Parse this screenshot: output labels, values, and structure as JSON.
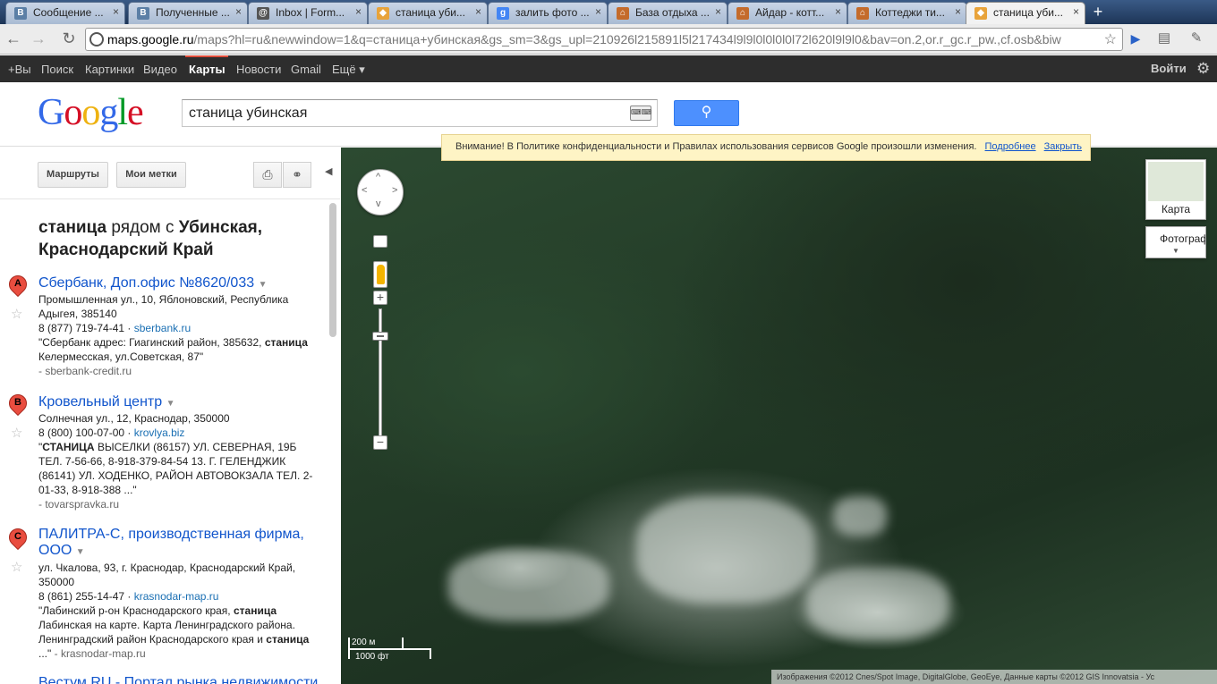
{
  "browser": {
    "tabs": [
      {
        "title": "Сообщение ...",
        "icon": "В",
        "icon_color": "#5b7fa6"
      },
      {
        "title": "Полученные ...",
        "icon": "В",
        "icon_color": "#5b7fa6"
      },
      {
        "title": "Inbox | Form...",
        "icon": "@",
        "icon_color": "#555555"
      },
      {
        "title": "станица уби...",
        "icon": "◆",
        "icon_color": "#e8a33a"
      },
      {
        "title": "залить фото ...",
        "icon": "g",
        "icon_color": "#4285f4"
      },
      {
        "title": "База отдыха ...",
        "icon": "⌂",
        "icon_color": "#c46b2b"
      },
      {
        "title": "Айдар - котт...",
        "icon": "⌂",
        "icon_color": "#c46b2b"
      },
      {
        "title": "Коттеджи ти...",
        "icon": "⌂",
        "icon_color": "#c46b2b"
      },
      {
        "title": "станица уби...",
        "icon": "◆",
        "icon_color": "#e8a33a",
        "active": true
      }
    ],
    "new_tab": "+",
    "url_host": "maps.google.ru",
    "url_rest": "/maps?hl=ru&newwindow=1&q=станица+убинская&gs_sm=3&gs_upl=210926l215891l5l217434l9l9l0l0l0l0l72l620l9l9l0&bav=on.2,or.r_gc.r_pw.,cf.osb&biw"
  },
  "gbar": {
    "items": [
      "+Вы",
      "Поиск",
      "Картинки",
      "Видео",
      "Карты",
      "Новости",
      "Gmail",
      "Ещё ▾"
    ],
    "selected": "Карты",
    "login": "Войти"
  },
  "search": {
    "query": "станица убинская",
    "logo": "Google"
  },
  "panel": {
    "routes_button": "Маршруты",
    "my_places_button": "Мои метки",
    "results_title_1": "станица",
    "results_title_2": " рядом с ",
    "results_title_3": "Убинская, Краснодарский Край",
    "results": [
      {
        "letter": "A",
        "name": "Сбербанк, Доп.офис №8620/033",
        "address": "Промышленная ул., 10, Яблоновский, Республика Адыгея, 385140",
        "phone": "8 (877) 719-74-41",
        "site": "sberbank.ru",
        "snippet_1": "\"Сбербанк адрес: Гиагинский район, 385632, ",
        "snippet_bold": "станица",
        "snippet_2": " Келермесская, ул.Советская, 87\"",
        "source": "- sberbank-credit.ru"
      },
      {
        "letter": "B",
        "name": "Кровельный центр",
        "address": "Солнечная ул., 12, Краснодар, 350000",
        "phone": "8 (800) 100-07-00",
        "site": "krovlya.biz",
        "snippet_1": "\"",
        "snippet_bold": "СТАНИЦА",
        "snippet_2": " ВЫСЕЛКИ (86157) УЛ. СЕВЕРНАЯ, 19Б ТЕЛ. 7-56-66, 8-918-379-84-54 13. Г. ГЕЛЕНДЖИК (86141) УЛ. ХОДЕНКО, РАЙОН АВТОВОКЗАЛА ТЕЛ. 2-01-33, 8-918-388 ...\"",
        "source": "- tovarspravka.ru"
      },
      {
        "letter": "C",
        "name": "ПАЛИТРА-С, производственная фирма, ООО",
        "address": "ул. Чкалова, 93, г. Краснодар, Краснодарский Край, 350000",
        "phone": "8 (861) 255-14-47",
        "site": "krasnodar-map.ru",
        "snippet_1": "\"Лабинский р-он Краснодарского края, ",
        "snippet_bold": "станица",
        "snippet_2": " Лабинская на карте. Карта Ленинградского района. Ленинградский район Краснодарского края и ",
        "snippet_bold2": "станица",
        "snippet_3": " ...\"",
        "source": "- krasnodar-map.ru"
      }
    ],
    "cut_off_text": "Вестум.RU - Портал рынка недвижимости"
  },
  "map": {
    "notice_text": "Внимание! В Политике конфиденциальности и Правилах использования сервисов Google произошли изменения.",
    "notice_more": "Подробнее",
    "notice_close": "Закрыть",
    "map_type_label": "Карта",
    "photo_label": "Фотограф",
    "scale_metric": "200 м",
    "scale_imperial": "1000 фт",
    "attribution": "Изображения ©2012 Cnes/Spot Image, DigitalGlobe, GeoEye, Данные карты ©2012 GIS Innovatsia - Ус"
  }
}
